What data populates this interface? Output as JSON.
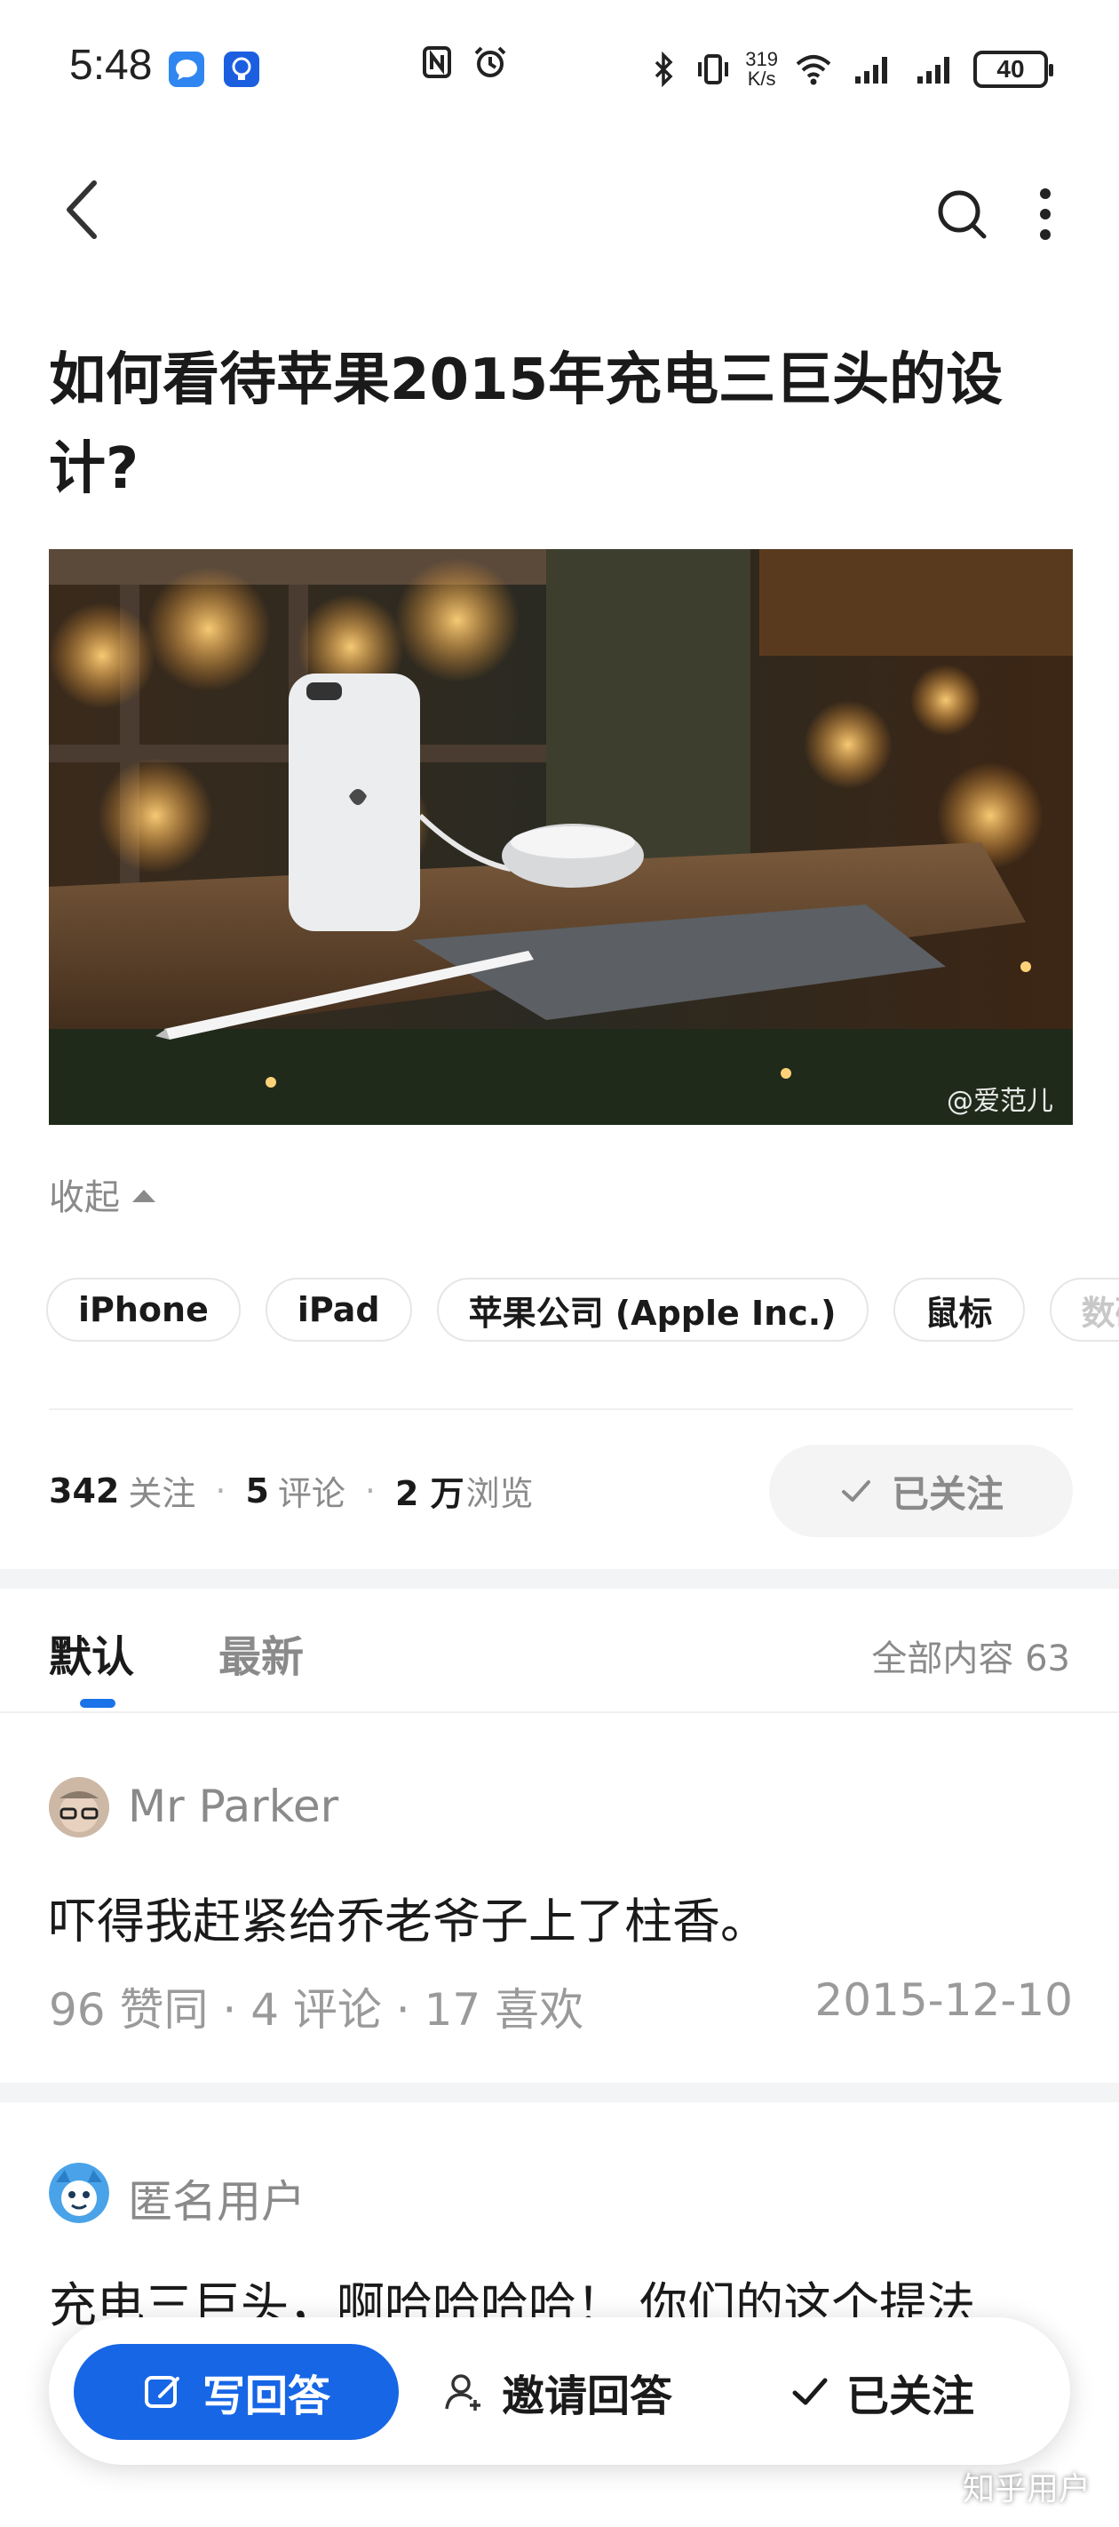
{
  "status_bar": {
    "time": "5:48",
    "net_speed_value": "319",
    "net_speed_unit": "K/s",
    "battery": "40"
  },
  "nav": {
    "icons": [
      "back-icon",
      "search-icon",
      "more-icon"
    ]
  },
  "question": {
    "title": "如何看待苹果2015年充电三巨头的设计?",
    "image_watermark": "@爱范儿",
    "collapse_label": "收起"
  },
  "tags": [
    "iPhone",
    "iPad",
    "苹果公司 (Apple Inc.)",
    "鼠标",
    "数码"
  ],
  "stats": {
    "followers": "342",
    "followers_label": "关注",
    "comments": "5",
    "comments_label": "评论",
    "views": "2 万",
    "views_label": "浏览",
    "follow_button": "已关注"
  },
  "sort_tabs": {
    "default": "默认",
    "latest": "最新",
    "all_content": "全部内容 63"
  },
  "answers": [
    {
      "author": "Mr Parker",
      "text": "吓得我赶紧给乔老爷子上了柱香。",
      "meta": "96  赞同 · 4  评论 · 17  喜欢",
      "date": "2015-12-10"
    },
    {
      "author": "匿名用户",
      "text": "充电三巨头，啊哈哈哈哈！ 你们的这个提法"
    }
  ],
  "bottom_bar": {
    "write": "写回答",
    "invite": "邀请回答",
    "followed": "已关注"
  },
  "brand_watermark": "知乎用户",
  "colors": {
    "accent": "#1766e6",
    "muted": "#8a8a8a",
    "text": "#1a1a1a"
  }
}
